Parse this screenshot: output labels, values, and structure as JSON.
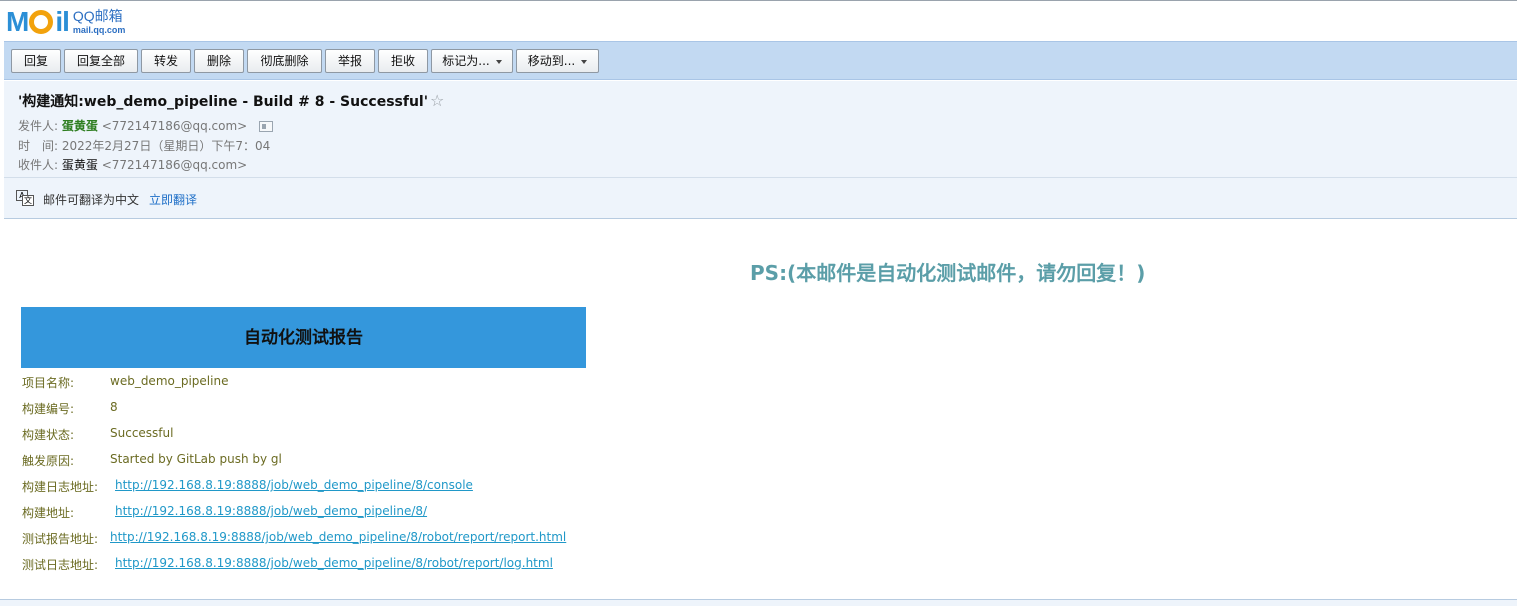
{
  "logo": {
    "word_m": "M",
    "word_il": "il",
    "cn": "QQ邮箱",
    "url": "mail.qq.com"
  },
  "toolbar": {
    "reply": "回复",
    "reply_all": "回复全部",
    "forward": "转发",
    "delete": "删除",
    "delete_permanent": "彻底删除",
    "report": "举报",
    "reject": "拒收",
    "mark_as": "标记为...",
    "move_to": "移动到..."
  },
  "mail": {
    "subject": "'构建通知:web_demo_pipeline - Build # 8 - Successful'",
    "star": "☆",
    "from_label": "发件人:",
    "from_name": "蛋黄蛋",
    "from_addr": "<772147186@qq.com>",
    "time_label": "时　间:",
    "time_value": "2022年2月27日（星期日）下午7：04",
    "to_label": "收件人:",
    "to_name": "蛋黄蛋",
    "to_addr": "<772147186@qq.com>"
  },
  "translate": {
    "text": "邮件可翻译为中文",
    "link": "立即翻译",
    "icon_a": "A",
    "icon_b": "文"
  },
  "body": {
    "ps": "PS:(本邮件是自动化测试邮件，请勿回复！)",
    "report_title": "自动化测试报告",
    "rows": [
      {
        "key": "项目名称:",
        "value": "web_demo_pipeline"
      },
      {
        "key": "构建编号:",
        "value": "8"
      },
      {
        "key": "构建状态:",
        "value": "Successful"
      },
      {
        "key": "触发原因:",
        "value": "Started by GitLab push by gl"
      },
      {
        "key": "构建日志地址:",
        "value": "http://192.168.8.19:8888/job/web_demo_pipeline/8/console"
      },
      {
        "key": "构建地址:",
        "value": "http://192.168.8.19:8888/job/web_demo_pipeline/8/"
      },
      {
        "key": "测试报告地址:",
        "value": "http://192.168.8.19:8888/job/web_demo_pipeline/8/robot/report/report.html"
      },
      {
        "key": "测试日志地址:",
        "value": "http://192.168.8.19:8888/job/web_demo_pipeline/8/robot/report/log.html"
      }
    ]
  },
  "colors": {
    "toolbar_bg": "#c2d9f2",
    "header_bg": "#eef4fb",
    "report_header_bg": "#3497dc",
    "ps_text": "#5b9ea8",
    "link": "#2098c8",
    "label_text": "#6b6b22"
  }
}
